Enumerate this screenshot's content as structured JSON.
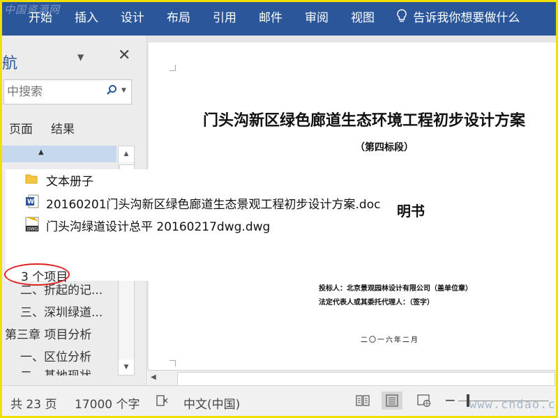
{
  "watermark": "中国资源网",
  "ribbon": {
    "tabs": [
      "开始",
      "插入",
      "设计",
      "布局",
      "引用",
      "邮件",
      "审阅",
      "视图"
    ],
    "tell_me": "告诉我你想要做什么"
  },
  "nav_pane": {
    "title": "航",
    "search_placeholder": "中搜索",
    "tabs": [
      "页面",
      "结果"
    ],
    "items": [
      "二、折起的记...",
      "三、深圳绿道...",
      "第三章  项目分析",
      "一、区位分析",
      "二、基地现状"
    ]
  },
  "explorer_popup": {
    "files": [
      {
        "name": "文本册子",
        "icon": "folder-icon"
      },
      {
        "name": "20160201门头沟新区绿色廊道生态景观工程初步设计方案.doc",
        "icon": "word-doc-icon"
      },
      {
        "name": "门头沟绿道设计总平 20160217dwg.dwg",
        "icon": "dwg-file-icon"
      }
    ],
    "item_count": "3 个项目"
  },
  "document": {
    "title": "门头沟新区绿色廊道生态环境工程初步设计方案",
    "subtitle": "（第四标段）",
    "partial_heading": "明书",
    "bidder_line": "投标人：北京景观园林设计有限公司（盖单位章）",
    "rep_line": "法定代表人或其委托代理人：（签字）",
    "date": "二〇一六年二月"
  },
  "status_bar": {
    "pages": "共 23 页",
    "words": "17000 个字",
    "language": "中文(中国)"
  },
  "site_watermark": "www.cndao.com",
  "colors": {
    "ribbon": "#2b579a",
    "highlight": "#c5d8ee",
    "annotation_ring": "#e02020",
    "frame": "#f0e000"
  }
}
